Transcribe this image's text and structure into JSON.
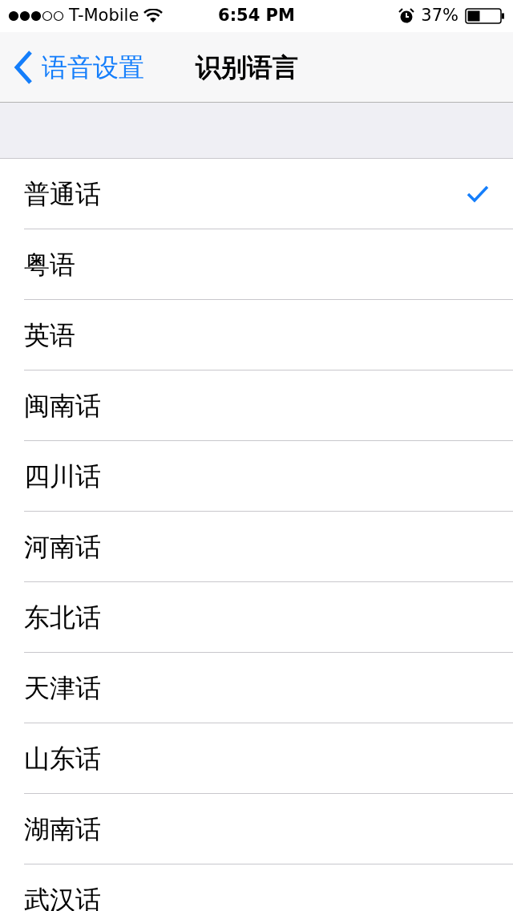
{
  "status_bar": {
    "carrier": "T-Mobile",
    "time": "6:54 PM",
    "battery": "37%"
  },
  "nav": {
    "back": "语音设置",
    "title": "识别语言"
  },
  "languages": [
    {
      "label": "普通话",
      "selected": true
    },
    {
      "label": "粤语",
      "selected": false
    },
    {
      "label": "英语",
      "selected": false
    },
    {
      "label": "闽南话",
      "selected": false
    },
    {
      "label": "四川话",
      "selected": false
    },
    {
      "label": "河南话",
      "selected": false
    },
    {
      "label": "东北话",
      "selected": false
    },
    {
      "label": "天津话",
      "selected": false
    },
    {
      "label": "山东话",
      "selected": false
    },
    {
      "label": "湖南话",
      "selected": false
    },
    {
      "label": "武汉话",
      "selected": false
    }
  ]
}
